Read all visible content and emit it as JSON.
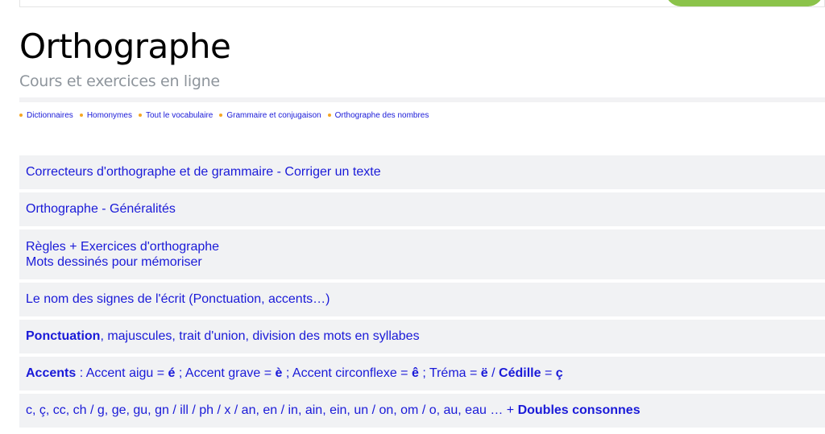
{
  "header": {
    "title": "Orthographe",
    "subtitle": "Cours et exercices en ligne"
  },
  "nav": {
    "items": [
      {
        "label": "Dictionnaires"
      },
      {
        "label": "Homonymes"
      },
      {
        "label": "Tout le vocabulaire"
      },
      {
        "label": "Grammaire et conjugaison"
      },
      {
        "label": "Orthographe des nombres"
      }
    ]
  },
  "rows": {
    "correcteurs": "Correcteurs d'orthographe et de grammaire - Corriger un texte",
    "generalites": "Orthographe - Généralités",
    "regles_line1": "Règles + Exercices d'orthographe",
    "regles_line2": "Mots dessinés pour mémoriser",
    "signes": "Le nom des signes de l'écrit (Ponctuation, accents…)",
    "ponctuation_bold": "Ponctuation",
    "ponctuation_rest": ", majuscules, trait d'union, division des mots en syllabes",
    "accents": {
      "accents_bold": "Accents",
      "t1": " : Accent aigu = ",
      "e_aigu": "é",
      "t2": " ; Accent grave = ",
      "e_grave": "è",
      "t3": " ; Accent circonflexe = ",
      "e_circ": "ê",
      "t4": " ; Tréma = ",
      "e_trema": "ë",
      "t5": " / ",
      "cedille_bold": "Cédille",
      "t6": " = ",
      "c_cedille": "ç"
    },
    "sons_text": "c, ç, cc, ch / g, ge, gu, gn / ill / ph / x / an, en / in, ain, ein, un / on, om / o, au, eau … + ",
    "sons_bold": "Doubles consonnes"
  },
  "colors": {
    "link": "#1a1ad8",
    "bullet": "#f5a623",
    "row_bg": "#f1f2f4",
    "subtitle": "#8e959c",
    "accent_green": "#8bc34a"
  }
}
